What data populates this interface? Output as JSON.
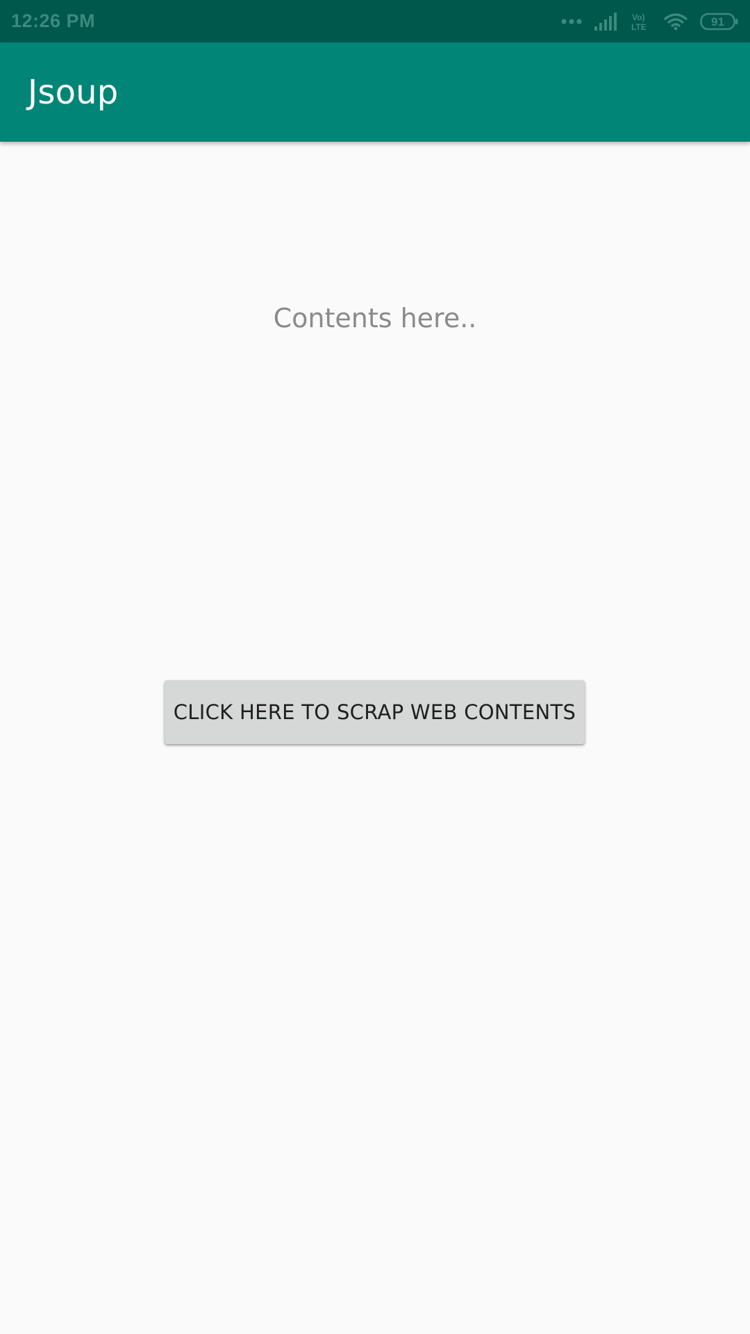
{
  "status_bar": {
    "time": "12:26 PM",
    "network_label": "Vo) LTE",
    "battery": "91",
    "icons": [
      "more-dots-icon",
      "signal-icon",
      "volte-icon",
      "wifi-icon",
      "battery-icon"
    ]
  },
  "app_bar": {
    "title": "Jsoup"
  },
  "main": {
    "content_text": "Contents here..",
    "scrap_button_label": "CLICK HERE TO SCRAP WEB CONTENTS"
  },
  "colors": {
    "status_bar": "#00574b",
    "app_bar": "#008577",
    "background": "#fafafa",
    "button": "#d6d7d7",
    "content_text": "#8a8a8a"
  }
}
